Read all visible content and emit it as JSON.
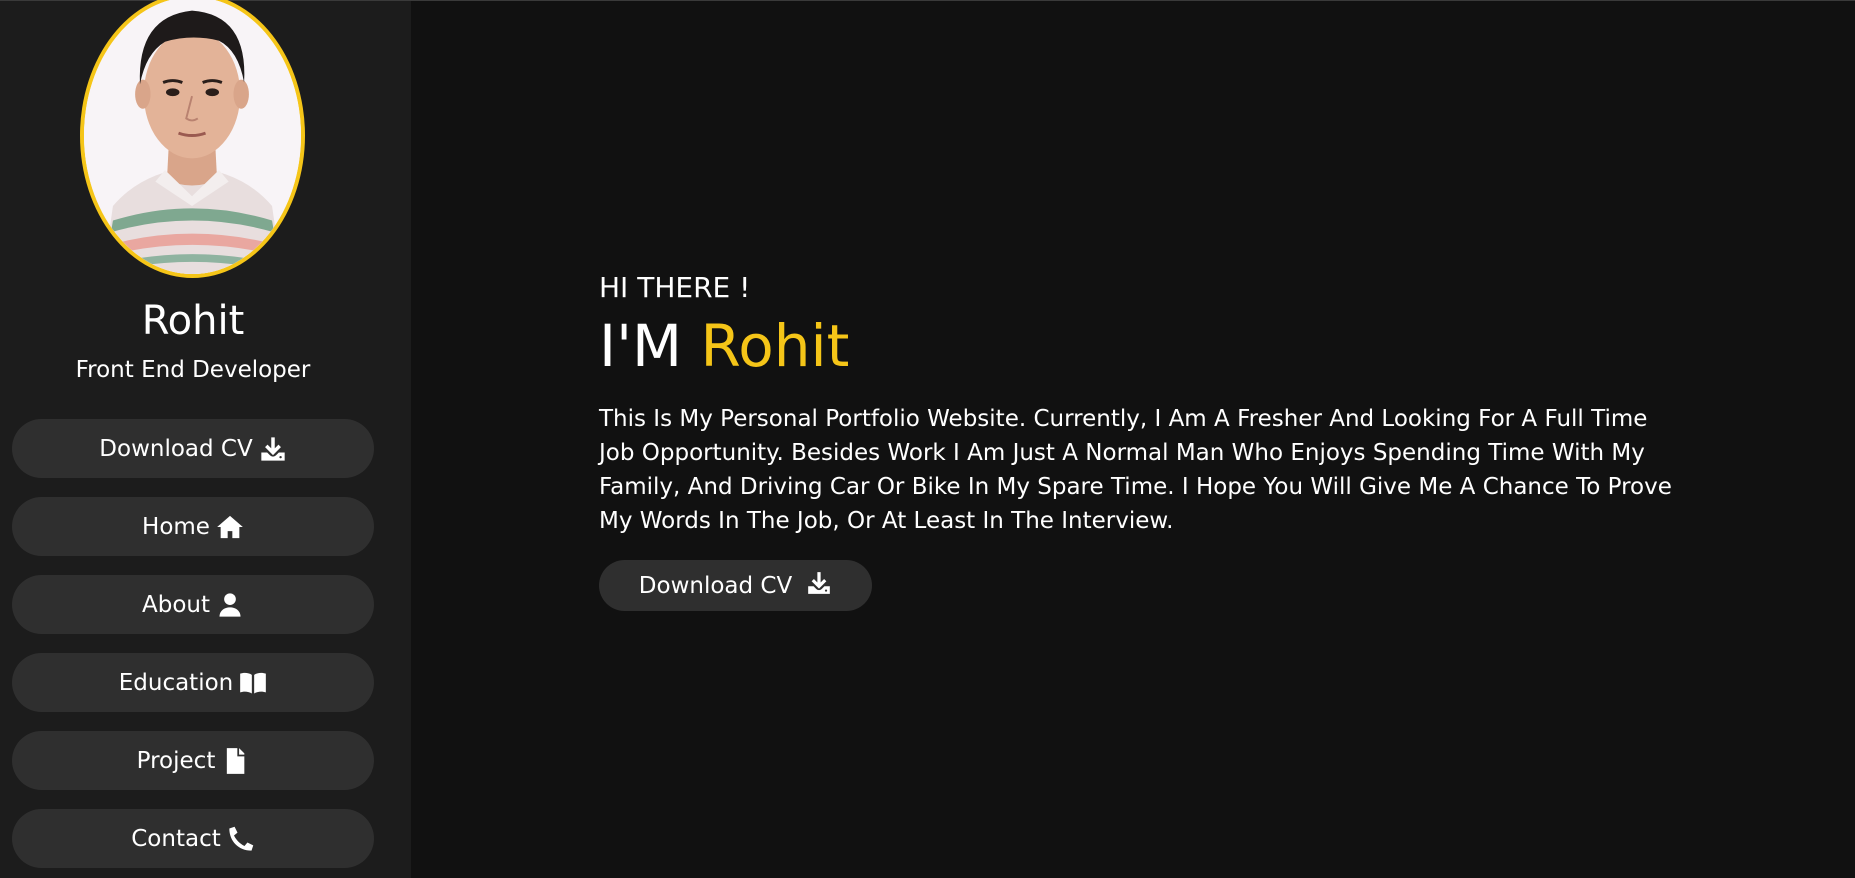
{
  "profile": {
    "name": "Rohit",
    "role": "Front End Developer",
    "accent_color": "#f5c518"
  },
  "sidebar": {
    "items": [
      {
        "label": "Download CV",
        "icon": "download-icon"
      },
      {
        "label": "Home",
        "icon": "home-icon"
      },
      {
        "label": "About",
        "icon": "user-icon"
      },
      {
        "label": "Education",
        "icon": "book-icon"
      },
      {
        "label": "Project",
        "icon": "file-icon"
      },
      {
        "label": "Contact",
        "icon": "phone-icon"
      }
    ]
  },
  "hero": {
    "greeting": "HI THERE !",
    "headline_prefix": "I'M",
    "headline_name": "Rohit",
    "intro": "This Is My Personal Portfolio Website. Currently, I Am A Fresher And Looking For A Full Time Job Opportunity. Besides Work I Am Just A Normal Man Who Enjoys Spending Time With My Family, And Driving Car Or Bike In My Spare Time. I Hope You Will Give Me A Chance To Prove My Words In The Job, Or At Least In The Interview.",
    "cta_label": "Download CV",
    "cta_icon": "download-icon"
  },
  "colors": {
    "background": "#111111",
    "sidebar": "#1c1c1c",
    "button": "#2f2f2f",
    "accent": "#f5c518"
  }
}
